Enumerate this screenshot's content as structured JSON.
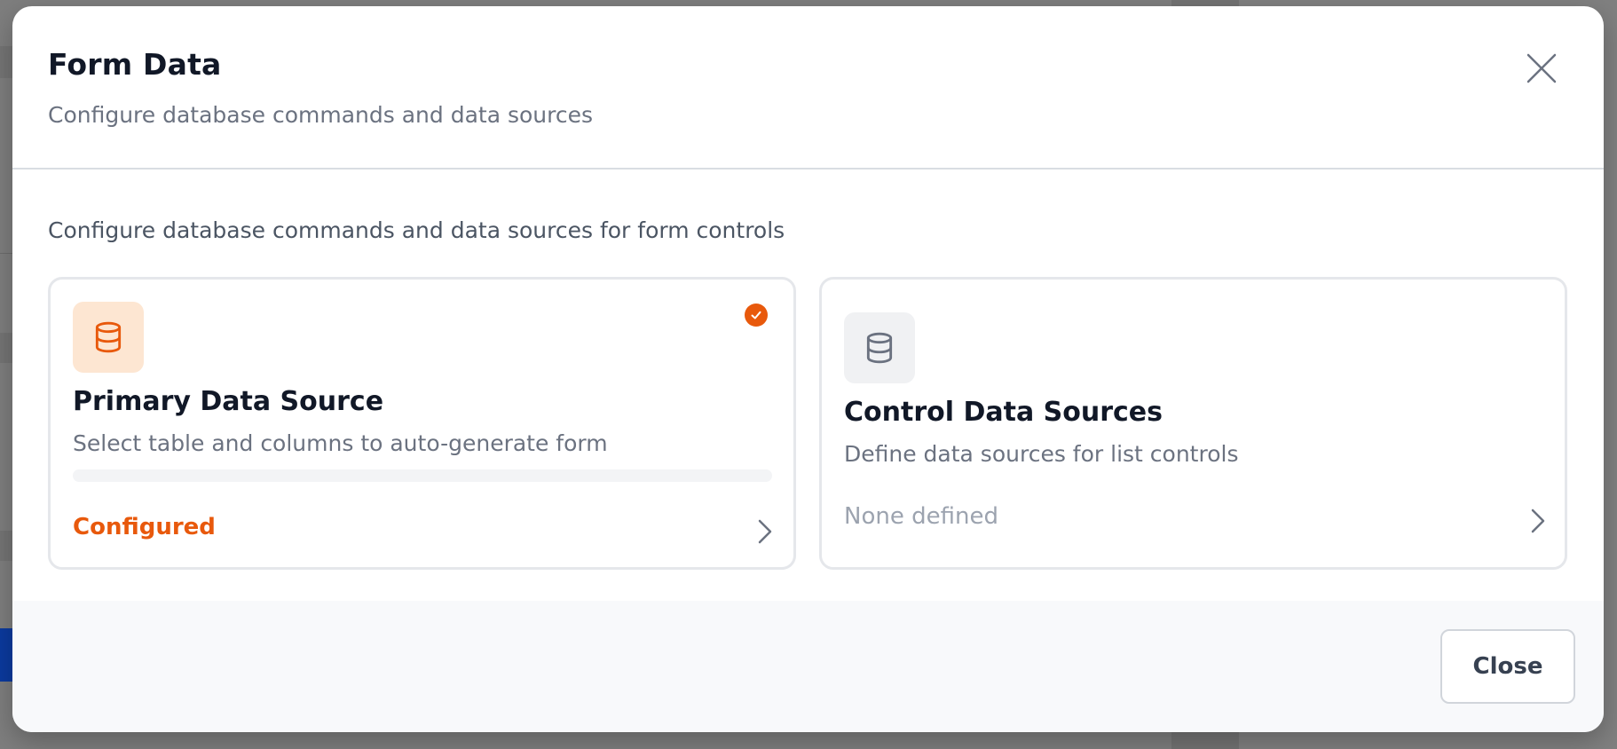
{
  "modal": {
    "title": "Form Data",
    "subtitle": "Configure database commands and data sources",
    "intro": "Configure database commands and data sources for form controls"
  },
  "cards": {
    "primary": {
      "title": "Primary Data Source",
      "description": "Select table and columns to auto-generate form",
      "status": "Configured",
      "selected": true,
      "icon": "database-icon",
      "accent_color": "#e8590c"
    },
    "control": {
      "title": "Control Data Sources",
      "description": "Define data sources for list controls",
      "status": "None defined",
      "icon": "database-icon"
    }
  },
  "footer": {
    "close_label": "Close"
  },
  "colors": {
    "accent": "#e8590c",
    "accent_light": "#fde6d2",
    "text_primary": "#111827",
    "text_muted": "#6b7280"
  }
}
